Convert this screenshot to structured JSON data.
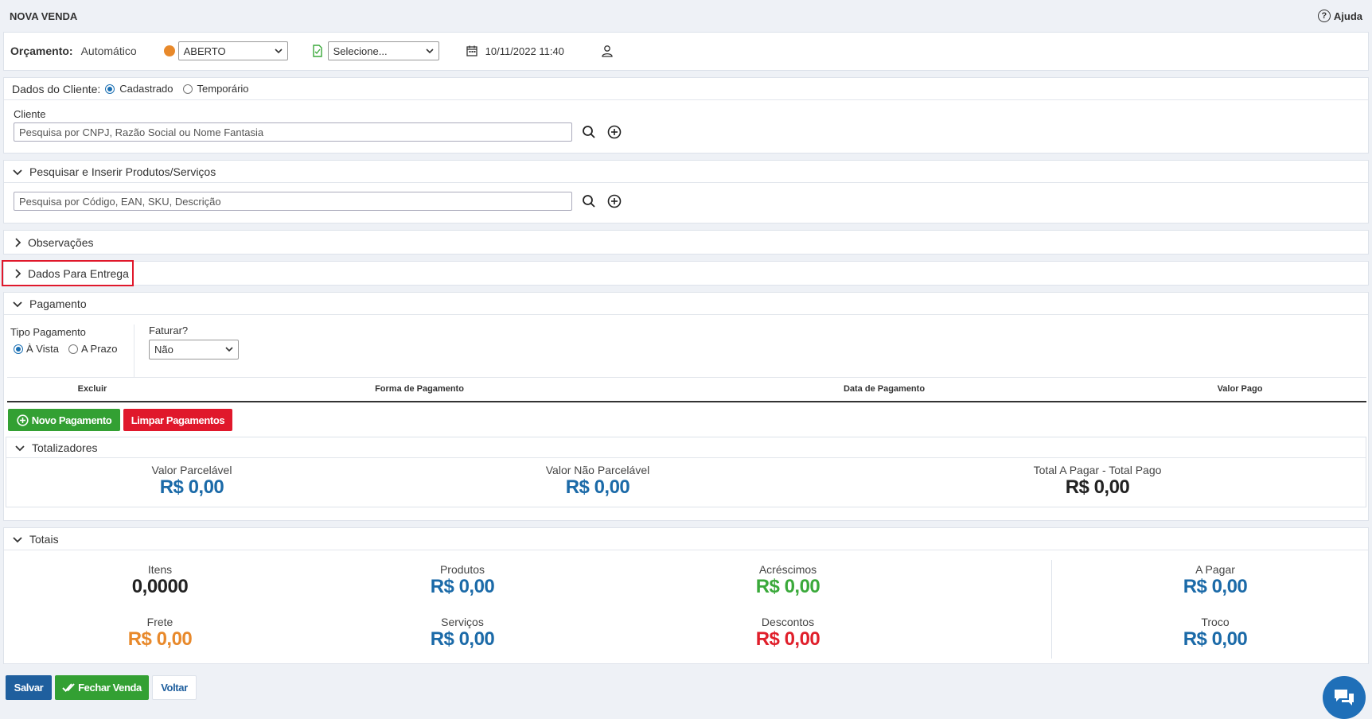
{
  "header": {
    "title": "NOVA VENDA",
    "help_label": "Ajuda"
  },
  "orcamento": {
    "label": "Orçamento:",
    "mode": "Automático",
    "status": "ABERTO",
    "select_placeholder": "Selecione...",
    "datetime": "10/11/2022 11:40"
  },
  "cliente": {
    "section_label": "Dados do Cliente:",
    "option_registered": "Cadastrado",
    "option_temporary": "Temporário",
    "field_label": "Cliente",
    "search_placeholder": "Pesquisa por CNPJ, Razão Social ou Nome Fantasia"
  },
  "produtos": {
    "title": "Pesquisar e Inserir Produtos/Serviços",
    "search_placeholder": "Pesquisa por Código, EAN, SKU, Descrição"
  },
  "observacoes": {
    "title": "Observações"
  },
  "entrega": {
    "title": "Dados Para Entrega"
  },
  "pagamento": {
    "title": "Pagamento",
    "tipo_label": "Tipo Pagamento",
    "option_avista": "À Vista",
    "option_aprazo": "A Prazo",
    "faturar_label": "Faturar?",
    "faturar_value": "Não",
    "columns": [
      "Excluir",
      "Forma de Pagamento",
      "Data de Pagamento",
      "Valor Pago"
    ],
    "new_payment_label": "Novo Pagamento",
    "clear_payments_label": "Limpar Pagamentos"
  },
  "totalizadores": {
    "title": "Totalizadores",
    "items": [
      {
        "label": "Valor Parcelável",
        "value": "R$ 0,00"
      },
      {
        "label": "Valor Não Parcelável",
        "value": "R$ 0,00"
      },
      {
        "label": "Total A Pagar - Total Pago",
        "value": "R$ 0,00"
      }
    ]
  },
  "totais": {
    "title": "Totais",
    "itens": {
      "label": "Itens",
      "value": "0,0000"
    },
    "frete": {
      "label": "Frete",
      "value": "R$ 0,00"
    },
    "produtos": {
      "label": "Produtos",
      "value": "R$ 0,00"
    },
    "servicos": {
      "label": "Serviços",
      "value": "R$ 0,00"
    },
    "acrescimos": {
      "label": "Acréscimos",
      "value": "R$ 0,00"
    },
    "descontos": {
      "label": "Descontos",
      "value": "R$ 0,00"
    },
    "a_pagar": {
      "label": "A Pagar",
      "value": "R$ 0,00"
    },
    "troco": {
      "label": "Troco",
      "value": "R$ 0,00"
    }
  },
  "footer": {
    "save_label": "Salvar",
    "close_sale_label": "Fechar Venda",
    "back_label": "Voltar"
  },
  "colors": {
    "primary_blue": "#1b6aa8",
    "green": "#3aa93a",
    "red": "#e01f2b",
    "orange": "#e8892b",
    "highlight_border": "#e0182b"
  }
}
